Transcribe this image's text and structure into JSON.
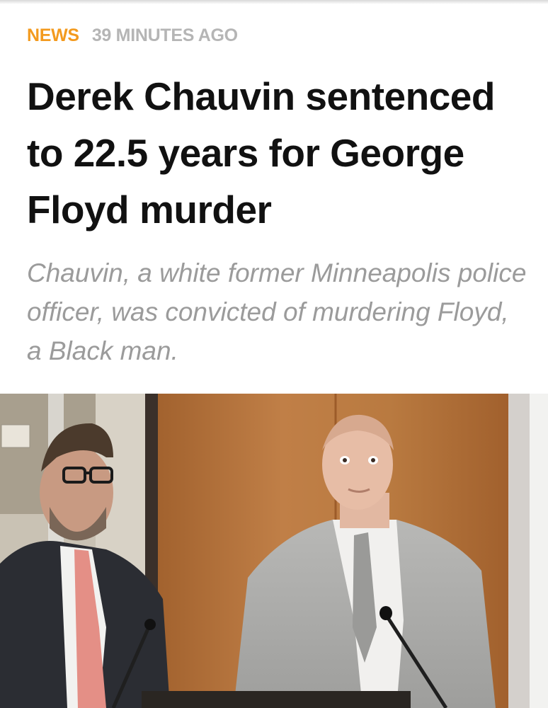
{
  "article": {
    "category": "NEWS",
    "timestamp": "39 MINUTES AGO",
    "headline": "Derek Chauvin sentenced to 22.5 years for George Floyd murder",
    "summary": "Chauvin, a white former Minneapolis police officer, was convicted of murdering Floyd, a Black man."
  },
  "colors": {
    "category": "#f39a1e",
    "timestamp": "#b5b5b5",
    "headline": "#111111",
    "summary": "#9b9b9b"
  }
}
